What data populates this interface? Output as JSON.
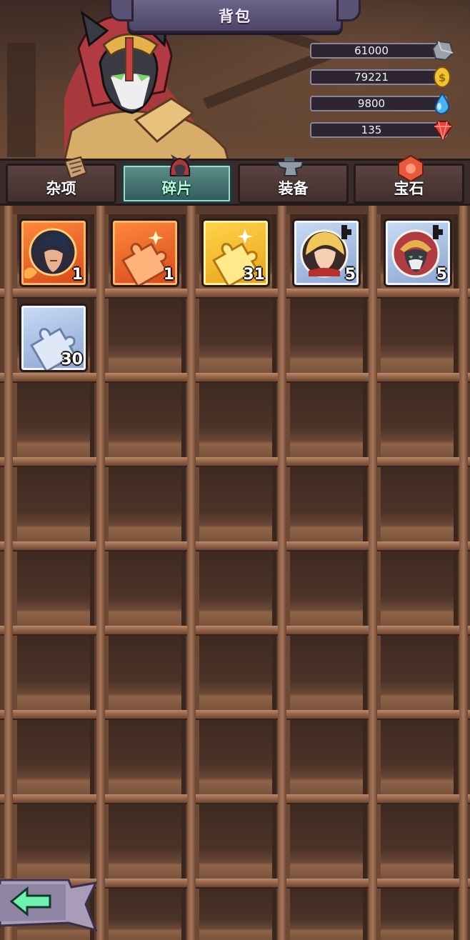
{
  "header": {
    "title": "背包"
  },
  "currencies": [
    {
      "value": "61000",
      "icon": "stone-icon"
    },
    {
      "value": "79221",
      "icon": "gold-coin-icon"
    },
    {
      "value": "9800",
      "icon": "water-drop-icon"
    },
    {
      "value": "135",
      "icon": "red-gem-icon"
    }
  ],
  "tabs": [
    {
      "label": "杂项",
      "icon": "scroll-icon",
      "active": false
    },
    {
      "label": "碎片",
      "icon": "hero-fragment-icon",
      "active": true
    },
    {
      "label": "装备",
      "icon": "anvil-icon",
      "active": false
    },
    {
      "label": "宝石",
      "icon": "gem-icon",
      "active": false
    }
  ],
  "items": [
    {
      "type": "hero-fragment",
      "rarity": "orange",
      "count": "1"
    },
    {
      "type": "puzzle-piece",
      "rarity": "orange",
      "count": "1"
    },
    {
      "type": "puzzle-piece",
      "rarity": "gold",
      "count": "31"
    },
    {
      "type": "hero-fragment",
      "rarity": "blue",
      "count": "5"
    },
    {
      "type": "hero-fragment",
      "rarity": "blue",
      "count": "5"
    },
    {
      "type": "puzzle-piece",
      "rarity": "blue",
      "count": "30"
    }
  ],
  "colors": {
    "tab_active": "#2f5a5a",
    "tab_active_text": "#b5ffd8",
    "orange_rarity": "#d6481a",
    "gold_rarity": "#e8a11c",
    "blue_rarity": "#8aa4d2"
  }
}
